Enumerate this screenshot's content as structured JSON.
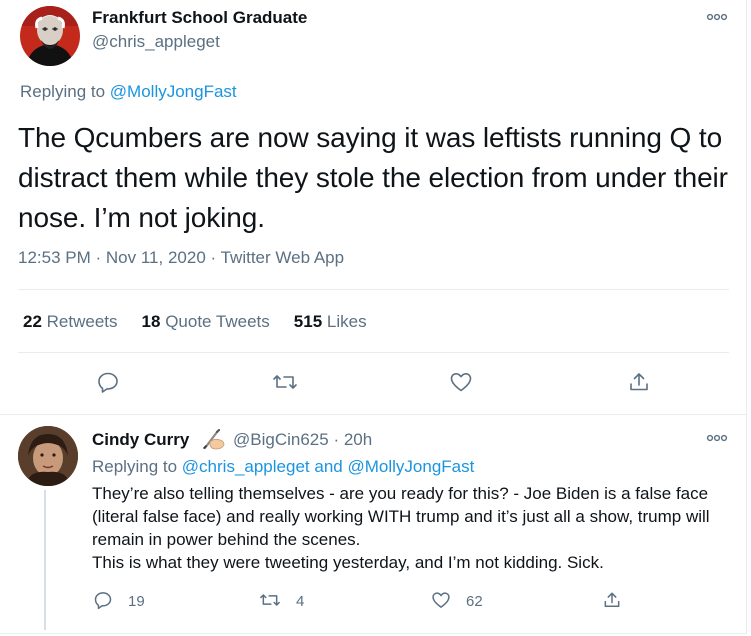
{
  "main_tweet": {
    "author_name": "Frankfurt School Graduate",
    "author_handle": "@chris_appleget",
    "replying_to_prefix": "Replying to",
    "replying_to_handle": "@MollyJongFast",
    "text": "The Qcumbers are now saying it was leftists running Q to distract them while they stole the election from under their nose. I’m not joking.",
    "time": "12:53 PM",
    "date": "Nov 11, 2020",
    "source": "Twitter Web App",
    "separator": "·",
    "stats": {
      "retweets_count": "22",
      "retweets_label": "Retweets",
      "quotes_count": "18",
      "quotes_label": "Quote Tweets",
      "likes_count": "515",
      "likes_label": "Likes"
    },
    "icons": [
      "reply-icon",
      "retweet-icon",
      "like-icon",
      "share-icon",
      "more-icon"
    ]
  },
  "reply_tweet": {
    "author_name": "Cindy Curry",
    "author_handle": "@BigCin625",
    "time_ago": "20h",
    "separator": "·",
    "replying_to_prefix": "Replying to",
    "replying_to_handle_1": "@chris_appleget",
    "replying_to_and": "and",
    "replying_to_handle_2": "@MollyJongFast",
    "text": "They’re also telling themselves - are you ready for this? - Joe Biden is a false face (literal false face) and really working WITH trump and it’s just all a show, trump will remain in power behind the scenes.\nThis is what they were tweeting yesterday, and I’m not kidding. Sick.",
    "reply_count": "19",
    "retweet_count": "4",
    "like_count": "62",
    "icons": [
      "writing-hand-emoji",
      "reply-icon",
      "retweet-icon",
      "like-icon",
      "share-icon",
      "more-icon"
    ]
  },
  "colors": {
    "text": "#0f1419",
    "secondary": "#5b7083",
    "link": "#1b95e0",
    "border": "#e6ecf0"
  }
}
